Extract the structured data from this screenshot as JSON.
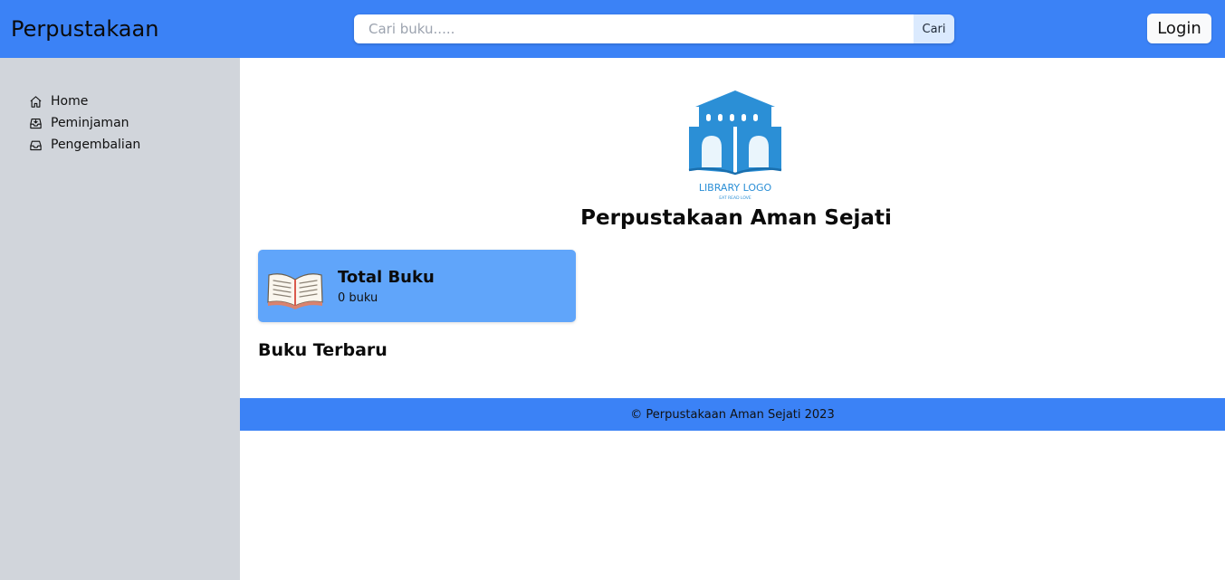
{
  "header": {
    "brand": "Perpustakaan",
    "search_placeholder": "Cari buku.....",
    "search_value": "",
    "search_button": "Cari",
    "login_button": "Login"
  },
  "sidebar": {
    "items": [
      {
        "label": "Home",
        "icon": "home-icon"
      },
      {
        "label": "Peminjaman",
        "icon": "inbox-download-icon"
      },
      {
        "label": "Pengembalian",
        "icon": "inbox-icon"
      }
    ]
  },
  "main": {
    "logo_text": "LIBRARY LOGO",
    "logo_tagline": "EAT READ LOVE",
    "title": "Perpustakaan Aman Sejati",
    "stat_card": {
      "title": "Total Buku",
      "value": "0 buku",
      "icon": "open-book-icon"
    },
    "section_title": "Buku Terbaru"
  },
  "footer": {
    "text": "© Perpustakaan Aman Sejati 2023"
  },
  "colors": {
    "header": "#3b82f6",
    "sidebar": "#d1d5db",
    "card": "#60a5fa",
    "footer": "#3b82f6",
    "logo": "#2b8fd6"
  }
}
